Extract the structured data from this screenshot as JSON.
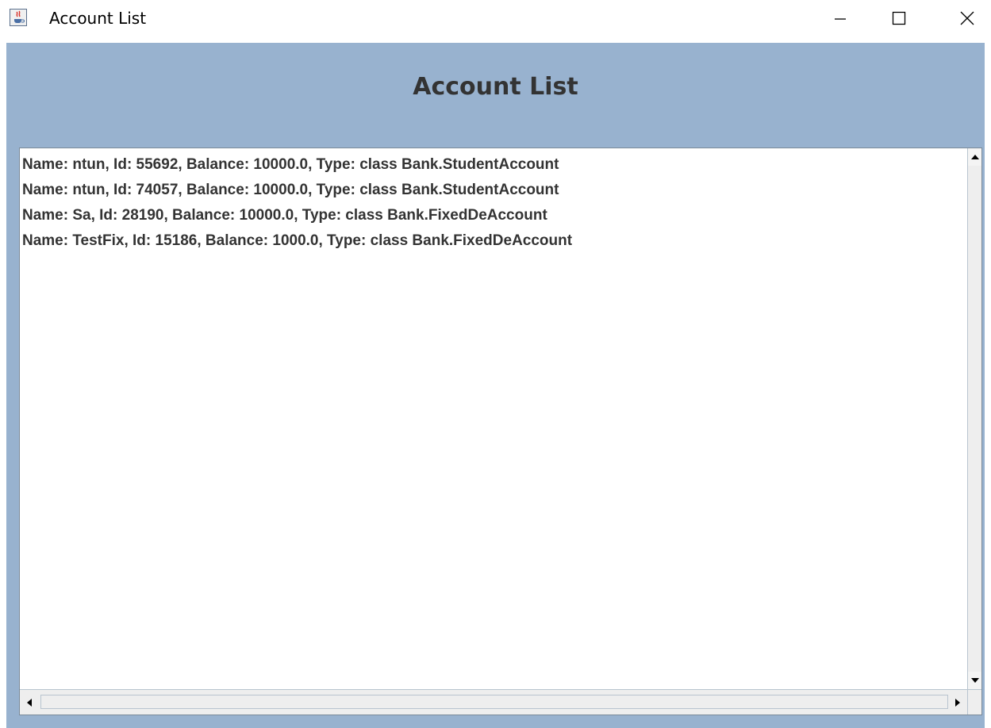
{
  "window": {
    "title": "Account List",
    "icon": "java-cup-icon",
    "controls": {
      "minimize_icon": "minimize-icon",
      "maximize_icon": "maximize-icon",
      "close_icon": "close-icon"
    }
  },
  "header": {
    "title": "Account List"
  },
  "colors": {
    "content_background": "#98b2cf",
    "text": "#333333"
  },
  "accounts": [
    "Name: ntun, Id: 55692, Balance: 10000.0, Type: class Bank.StudentAccount",
    "Name: ntun, Id: 74057, Balance: 10000.0, Type: class Bank.StudentAccount",
    "Name: Sa, Id: 28190, Balance: 10000.0, Type: class Bank.FixedDeAccount",
    "Name: TestFix, Id: 15186, Balance: 1000.0, Type: class Bank.FixedDeAccount"
  ]
}
